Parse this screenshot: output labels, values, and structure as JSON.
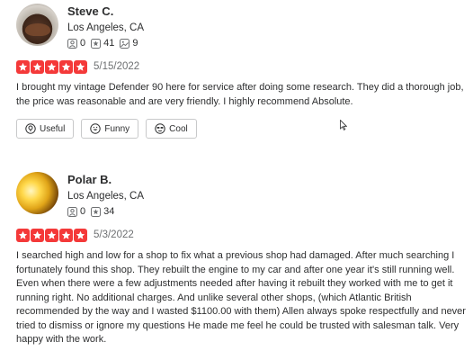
{
  "reviews": [
    {
      "author": "Steve C.",
      "location": "Los Angeles, CA",
      "friends": "0",
      "reviews_count": "41",
      "photos": "9",
      "rating": 5,
      "date": "5/15/2022",
      "text": "I brought my vintage Defender 90 here for service after doing some research.  They did a thorough job, the price was reasonable and are very friendly.  I highly recommend Absolute.",
      "actions": {
        "useful": "Useful",
        "funny": "Funny",
        "cool": "Cool"
      }
    },
    {
      "author": "Polar B.",
      "location": "Los Angeles, CA",
      "friends": "0",
      "reviews_count": "34",
      "rating": 5,
      "date": "5/3/2022",
      "text": "I searched high and low for a shop to fix what a previous shop had damaged. After much searching I fortunately found this shop. They rebuilt the engine to my car and after one year it's still running well. Even when there were a few adjustments needed after having it rebuilt they worked with me to get it running right. No additional charges. And unlike several other shops, (which Atlantic British recommended by the way and I wasted $1100.00 with them) Allen always spoke respectfully and never tried to dismiss or ignore my questions He made me feel he could be trusted with salesman talk. Very happy with the work."
    }
  ],
  "colors": {
    "star_red": "#f43939",
    "text": "#2d2e2f",
    "muted": "#6e7072",
    "border": "#c8c9ca"
  },
  "icons": {
    "friends": "friends-icon",
    "reviews": "star-badge-icon",
    "photos": "photo-icon",
    "useful": "lightbulb-icon",
    "funny": "laugh-face-icon",
    "cool": "sunglasses-face-icon"
  }
}
